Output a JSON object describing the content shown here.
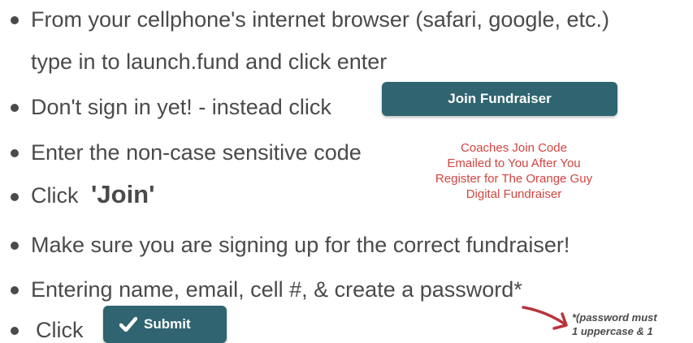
{
  "instructions": {
    "item1_line1": "From your cellphone's internet browser (safari, google, etc.)",
    "item1_line2": "type in  to launch.fund and click enter",
    "item2_text": "Don't sign in yet! - instead click",
    "item3_text": "Enter the non-case sensitive code",
    "item4_text": "Click",
    "item4_bold": "'Join'",
    "item5_text": "Make sure you are signing up for the correct fundraiser!",
    "item6_text": "Entering name, email, cell #, & create a password*",
    "item7_text": "Click"
  },
  "buttons": {
    "join_fundraiser_label": "Join Fundraiser",
    "submit_label": "Submit",
    "submit_icon": "checkmark-icon"
  },
  "code_note": {
    "line1": "Coaches Join Code",
    "line2": "Emailed to You  After You",
    "line3": "Register for The Orange Guy",
    "line4": "Digital Fundraiser"
  },
  "password_note": {
    "line1": "*(password must",
    "line2": "1 uppercase & 1"
  },
  "colors": {
    "button_teal": "#2f6470",
    "note_red": "#d2443f",
    "arrow_red": "#b8333b",
    "text_gray": "#4a4a4a"
  }
}
